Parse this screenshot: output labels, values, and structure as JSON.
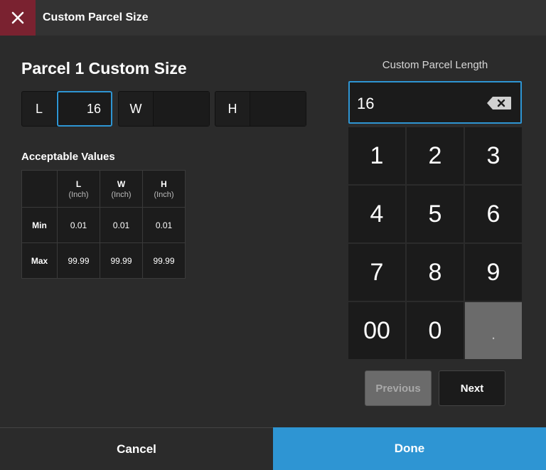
{
  "header": {
    "title": "Custom Parcel Size",
    "close_icon": "close-icon",
    "close_color": "#7a2230"
  },
  "form": {
    "heading": "Parcel 1 Custom Size",
    "fields": [
      {
        "label": "L",
        "value": "16",
        "active": true
      },
      {
        "label": "W",
        "value": "",
        "active": false
      },
      {
        "label": "H",
        "value": "",
        "active": false
      }
    ]
  },
  "acceptable": {
    "title": "Acceptable Values",
    "columns": [
      {
        "name": "L",
        "unit": "(Inch)"
      },
      {
        "name": "W",
        "unit": "(Inch)"
      },
      {
        "name": "H",
        "unit": "(Inch)"
      }
    ],
    "rows": [
      {
        "label": "Min",
        "values": [
          "0.01",
          "0.01",
          "0.01"
        ]
      },
      {
        "label": "Max",
        "values": [
          "99.99",
          "99.99",
          "99.99"
        ]
      }
    ]
  },
  "numpad": {
    "label": "Custom Parcel Length",
    "display_value": "16",
    "backspace_icon": "backspace-icon",
    "keys": [
      "1",
      "2",
      "3",
      "4",
      "5",
      "6",
      "7",
      "8",
      "9",
      "00",
      "0",
      "."
    ],
    "accent_color": "#2e95d3"
  },
  "nav": {
    "previous_label": "Previous",
    "next_label": "Next"
  },
  "footer": {
    "cancel_label": "Cancel",
    "done_label": "Done"
  }
}
